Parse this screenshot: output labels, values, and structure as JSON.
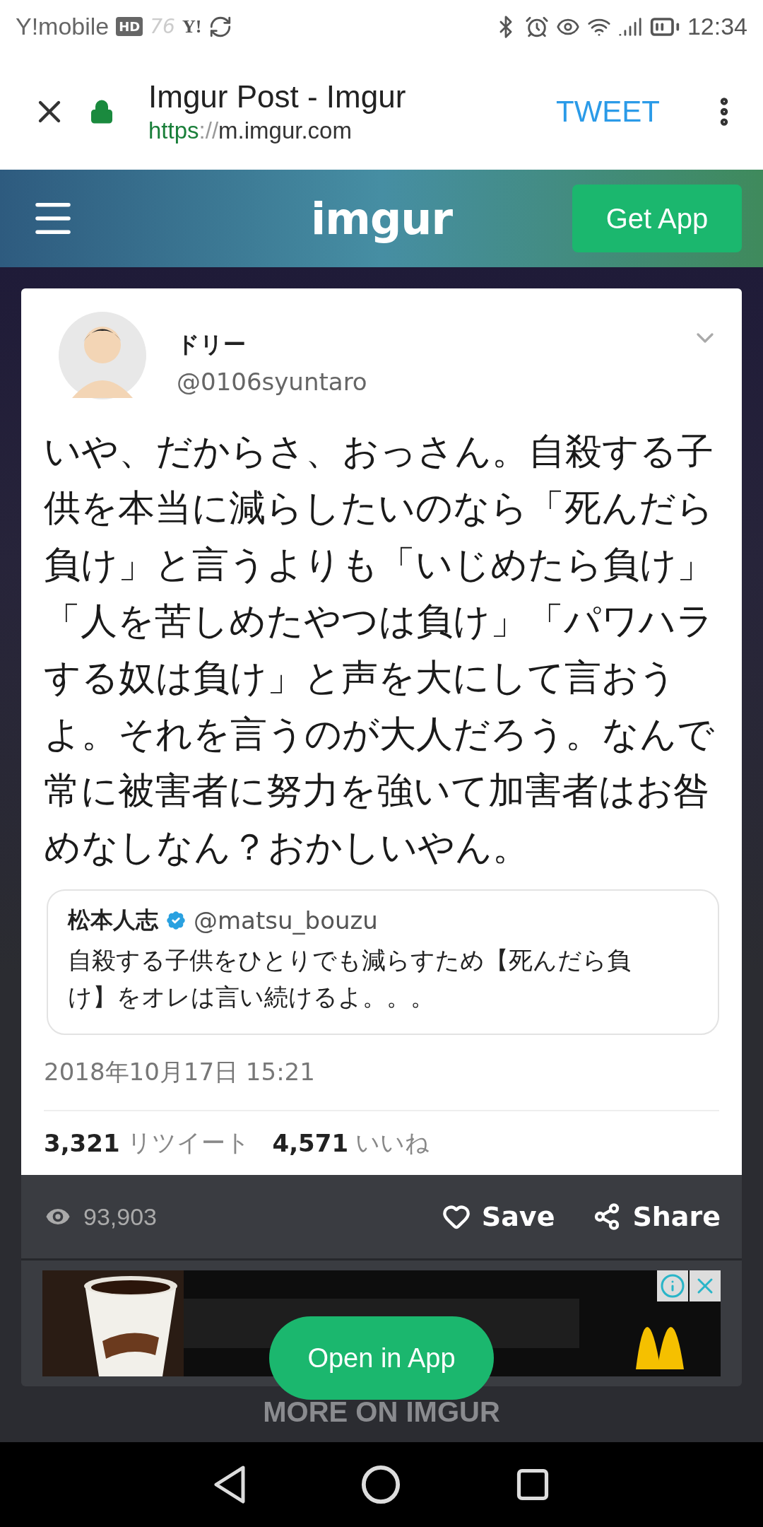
{
  "status_bar": {
    "carrier": "Y!mobile",
    "hd_badge": "HD",
    "network_number": "76",
    "yahoo_mark": "Y!",
    "time": "12:34"
  },
  "browser_bar": {
    "title": "Imgur Post - Imgur",
    "url_scheme": "https",
    "url_separator": "://",
    "url_host": "m.imgur.com",
    "action": "TWEET"
  },
  "site_nav": {
    "logo": "imgur",
    "button": "Get App"
  },
  "tweet": {
    "name": "ドリー",
    "handle": "@0106syuntaro",
    "text": "いや、だからさ、おっさん。自殺する子供を本当に減らしたいのなら「死んだら負け」と言うよりも「いじめたら負け」「人を苦しめたやつは負け」「パワハラする奴は負け」と声を大にして言おうよ。それを言うのが大人だろう。なんで常に被害者に努力を強いて加害者はお咎めなしなん？おかしいやん。",
    "quote": {
      "name": "松本人志",
      "handle": "@matsu_bouzu",
      "text": "自殺する子供をひとりでも減らすため【死んだら負け】をオレは言い続けるよ。。。"
    },
    "date": "2018年10月17日 15:21",
    "stats": [
      {
        "count": "3,321",
        "label": "リツイート"
      },
      {
        "count": "4,571",
        "label": "いいね"
      }
    ]
  },
  "post_actions": {
    "views": "93,903",
    "save": "Save",
    "share": "Share"
  },
  "open_in_app": "Open in App",
  "more_heading": "MORE ON IMGUR"
}
